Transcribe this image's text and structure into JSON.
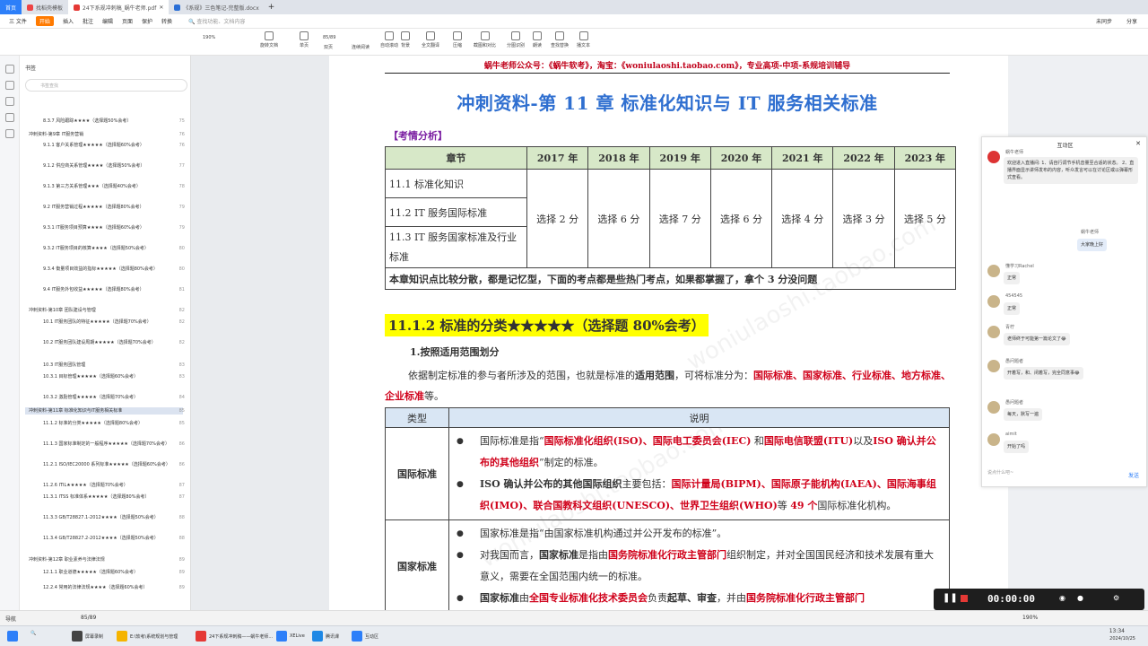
{
  "tabs": [
    {
      "label": "首页"
    },
    {
      "label": "找稻壳模板"
    },
    {
      "label": "24下系规冲刺稿_蜗牛老师.pdf"
    },
    {
      "label": "《系规》三色笔记-完整版.docx"
    }
  ],
  "menu": [
    "三 文件",
    "开始",
    "插入",
    "批注",
    "编辑",
    "页面",
    "保护",
    "转换"
  ],
  "menu_search": "查找功能、文档内容",
  "menu_right": [
    "未同步",
    "分享"
  ],
  "toolbar": {
    "zoom": "190%",
    "page": "85/89",
    "buttons": [
      "旋转文档",
      "单页",
      "双页",
      "连续阅读",
      "自动滚动",
      "背景",
      "全文翻译",
      "压缩",
      "截图和对比",
      "分图识别",
      "朗读",
      "查找替换",
      "播文本"
    ]
  },
  "outline": {
    "title": "书签",
    "search_placeholder": "书签查找",
    "items": [
      {
        "label": "8.3.7 风险跟踪★★★★（选择题50%会考）",
        "page": "75"
      },
      {
        "label": "冲刺资料-第9章 IT服务营销",
        "page": "76"
      },
      {
        "label": "9.1.1 客户关系管理★★★★★（选择题60%会考）",
        "page": "76"
      },
      {
        "label": "9.1.2 供应商关系管理★★★★（选择题50%会考）",
        "page": "77"
      },
      {
        "label": "9.1.3 第三方关系管理★★★（选择题40%会考）",
        "page": "78"
      },
      {
        "label": "9.2 IT服务营销过程★★★★★（选择题80%会考）",
        "page": "79"
      },
      {
        "label": "9.3.1 IT服务项目预算★★★★（选择题60%会考）",
        "page": "79"
      },
      {
        "label": "9.3.2 IT服务项目的核算★★★★（选择题50%会考）",
        "page": "80"
      },
      {
        "label": "9.3.4 衡量项目效益的指标★★★★★（选择题80%会考）",
        "page": "80"
      },
      {
        "label": "9.4 IT服务外包收益★★★★★（选择题80%会考）",
        "page": "81"
      },
      {
        "label": "冲刺资料-第10章 团队建设与管理",
        "page": "82"
      },
      {
        "label": "10.1 IT服务团队的特征★★★★★（选择题70%会考）",
        "page": "82"
      },
      {
        "label": "10.2 IT服务团队建设周期★★★★★（选择题70%会考）",
        "page": "82"
      },
      {
        "label": "10.3 IT服务团队管理",
        "page": "83"
      },
      {
        "label": "10.3.1 目标管理★★★★★（选择题60%会考）",
        "page": "83"
      },
      {
        "label": "10.3.2 激励管理★★★★★（选择题70%会考）",
        "page": "84"
      },
      {
        "label": "冲刺资料-第11章 标准化知识与IT服务相关标准",
        "page": "85"
      },
      {
        "label": "11.1.2 标准的分类★★★★★（选择题80%会考）",
        "page": "85"
      },
      {
        "label": "11.1.3 国家标准制定的一般程序★★★★★（选择题70%会考）",
        "page": "86"
      },
      {
        "label": "11.2.1 ISO/IEC20000 系列标准★★★★★（选择题60%会考）",
        "page": "86"
      },
      {
        "label": "11.2.6 ITIL★★★★★（选择题70%会考）",
        "page": "87"
      },
      {
        "label": "11.3.1 ITSS 标准体系★★★★★（选择题80%会考）",
        "page": "87"
      },
      {
        "label": "11.3.3 GB/T28827.1-2012★★★★（选择题50%会考）",
        "page": "88"
      },
      {
        "label": "11.3.4 GB/T28827.2-2012★★★★（选择题50%会考）",
        "page": "88"
      },
      {
        "label": "冲刺资料-第12章 职业素养与法律法规",
        "page": "89"
      },
      {
        "label": "12.1.1 职业道德★★★★★（选择题60%会考）",
        "page": "89"
      },
      {
        "label": "12.2.4 常用的法律法规★★★★（选择题60%会考）",
        "page": "89"
      }
    ]
  },
  "doc": {
    "header": "蜗牛老师公众号：《蜗牛软考》，淘宝：《woniulaoshi.taobao.com》，专业高项-中项-系规培训辅导",
    "title": "冲刺资料-第 11 章  标准化知识与 IT 服务相关标准",
    "analysis_label": "【考情分析】",
    "table1": {
      "headers": [
        "章节",
        "2017 年",
        "2018 年",
        "2019 年",
        "2020 年",
        "2021 年",
        "2022 年",
        "2023 年"
      ],
      "topics": [
        "11.1  标准化知识",
        "11.2 IT 服务国际标准",
        "11.3 IT 服务国家标准及行业标准"
      ],
      "scores": [
        "选择 2 分",
        "选择 6 分",
        "选择 7 分",
        "选择 6 分",
        "选择 4 分",
        "选择 3 分",
        "选择 5 分"
      ],
      "summary": "本章知识点比较分散，都是记忆型，下面的考点都是些热门考点，如果都掌握了，拿个 3 分没问题"
    },
    "section_heading": "11.1.2  标准的分类★★★★★（选择题 80%会考）",
    "sub_heading": "1.按照适用范围划分",
    "para_a": "依据制定标准的参与者所涉及的范围，也就是标准的",
    "para_b": "适用范围",
    "para_c": "，可将标准分为：",
    "para_d": "国际标准、国家标准、行业标准、地方标准、企业标准",
    "para_e": "等。",
    "table2": {
      "headers": [
        "类型",
        "说明"
      ],
      "row1_type": "国际标准",
      "r1b1_a": "国际标准是指“",
      "r1b1_b": "国际标准化组织(ISO)、国际电工委员会(IEC)",
      "r1b1_c": " 和",
      "r1b1_d": "国际电信联盟(ITU)",
      "r1b1_e": "以及",
      "r1b1_f": "ISO 确认并公布的其他组织",
      "r1b1_g": "”制定的标准。",
      "r1b2_a": "ISO 确认并公布的其他国际组织",
      "r1b2_b": "主要包括：",
      "r1b2_c": "国际计量局(BIPM)、国际原子能机构(IAEA)、国际海事组织(IMO)、联合国教科文组织(UNESCO)、世界卫生组织(WHO)",
      "r1b2_d": "等 ",
      "r1b2_e": "49 个",
      "r1b2_f": "国际标准化机构。",
      "row2_type": "国家标准",
      "r2b1": "国家标准是指“由国家标准机构通过并公开发布的标准”。",
      "r2b2_a": "对我国而言，",
      "r2b2_b": "国家标准",
      "r2b2_c": "是指由",
      "r2b2_d": "国务院标准化行政主管部门",
      "r2b2_e": "组织制定，并对全国国民经济和技术发展有重大意义，需要在全国范围内统一的标准。",
      "r2b3_a": "国家标准",
      "r2b3_b": "由",
      "r2b3_c": "全国专业标准化技术委员会",
      "r2b3_d": "负责",
      "r2b3_e": "起草、审查",
      "r2b3_f": "，并由",
      "r2b3_g": "国务院标准化行政主管部门"
    },
    "watermark": "woniulaoshi.taobao.com"
  },
  "panel": {
    "title": "互动区",
    "announce_sender": "蜗牛老师",
    "announce": "欢迎进入直播间: 1、请自行调节手机音量至合适的状态。 2、直播界面显示讲师发布的内容，听众发言可以在讨论区或以弹幕形式查看。",
    "teacher_name": "蜗牛老师",
    "teacher_msg": "大家晚上好",
    "msgs": [
      {
        "user": "懂学习Rachel",
        "text": "正常"
      },
      {
        "user": "454545",
        "text": "正常"
      },
      {
        "user": "青柠",
        "text": "老师终于可能第一篇论文了😂"
      },
      {
        "user": "愚问题者",
        "text": "开着写，和、闭着写，完全同意事😂"
      },
      {
        "user": "愚问题者",
        "text": "每天，默写一遍"
      },
      {
        "user": "aimit",
        "text": "开始了吗"
      }
    ],
    "input_placeholder": "说点什么吧~",
    "send": "发送"
  },
  "recorder": {
    "time": "00:00:00"
  },
  "status": {
    "nav": "导航",
    "page": "85/89",
    "zoom": "190%"
  },
  "taskbar": {
    "items": [
      "屏幕录制",
      "E:\\软考\\系统规划与管理",
      "24下系规冲刺稿——蜗牛老师...",
      "XELive",
      "腾讯课",
      "互动区"
    ],
    "time": "13:34",
    "date": "2024/10/25"
  }
}
